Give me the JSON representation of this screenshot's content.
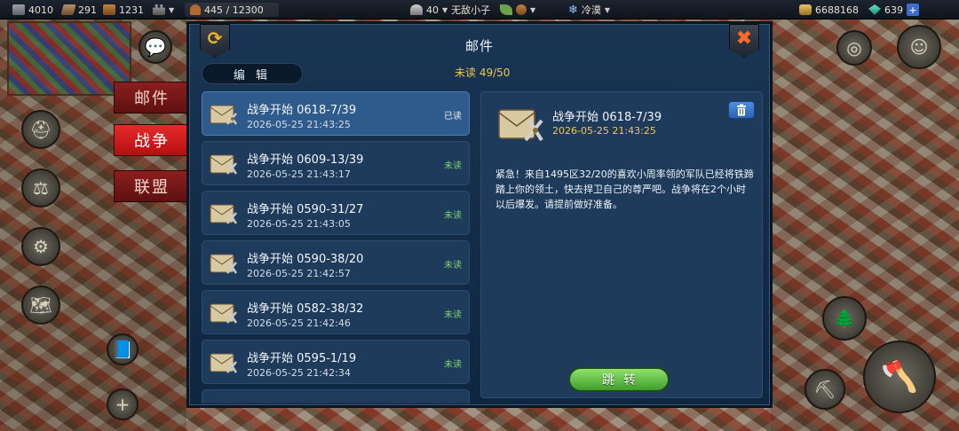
{
  "topbar": {
    "stone": "4010",
    "iron": "291",
    "wood": "1231",
    "population": "445 / 12300",
    "rank": "40",
    "player_name": "无敌小子",
    "weather": "冷漠",
    "gold": "6688168",
    "gems": "639",
    "plus_label": "+"
  },
  "side_tabs": {
    "mail": "邮件",
    "war": "战争",
    "alliance": "联盟"
  },
  "dialog": {
    "title": "邮件",
    "edit_label": "编 辑",
    "unread_text": "未读 49/50"
  },
  "mails": [
    {
      "title": "战争开始  0618-7/39",
      "time": "2026-05-25  21:43:25",
      "status": "已读"
    },
    {
      "title": "战争开始  0609-13/39",
      "time": "2026-05-25  21:43:17",
      "status": "未读"
    },
    {
      "title": "战争开始  0590-31/27",
      "time": "2026-05-25  21:43:05",
      "status": "未读"
    },
    {
      "title": "战争开始  0590-38/20",
      "time": "2026-05-25  21:42:57",
      "status": "未读"
    },
    {
      "title": "战争开始  0582-38/32",
      "time": "2026-05-25  21:42:46",
      "status": "未读"
    },
    {
      "title": "战争开始  0595-1/19",
      "time": "2026-05-25  21:42:34",
      "status": "未读"
    }
  ],
  "detail": {
    "title": "战争开始  0618-7/39",
    "time": "2026-05-25  21:43:25",
    "body": "紧急！来自1495区32/20的喜欢小周率领的军队已经将铁蹄踏上你的领土，快去捍卫自己的尊严吧。战争将在2个小时以后爆发。请提前做好准备。",
    "jump_label": "跳转"
  },
  "colors": {
    "accent_gold": "#f0c84d",
    "unread_green": "#7cd36a",
    "active_tab_red": "#e82a2a",
    "panel_blue": "#1f3b5c"
  }
}
